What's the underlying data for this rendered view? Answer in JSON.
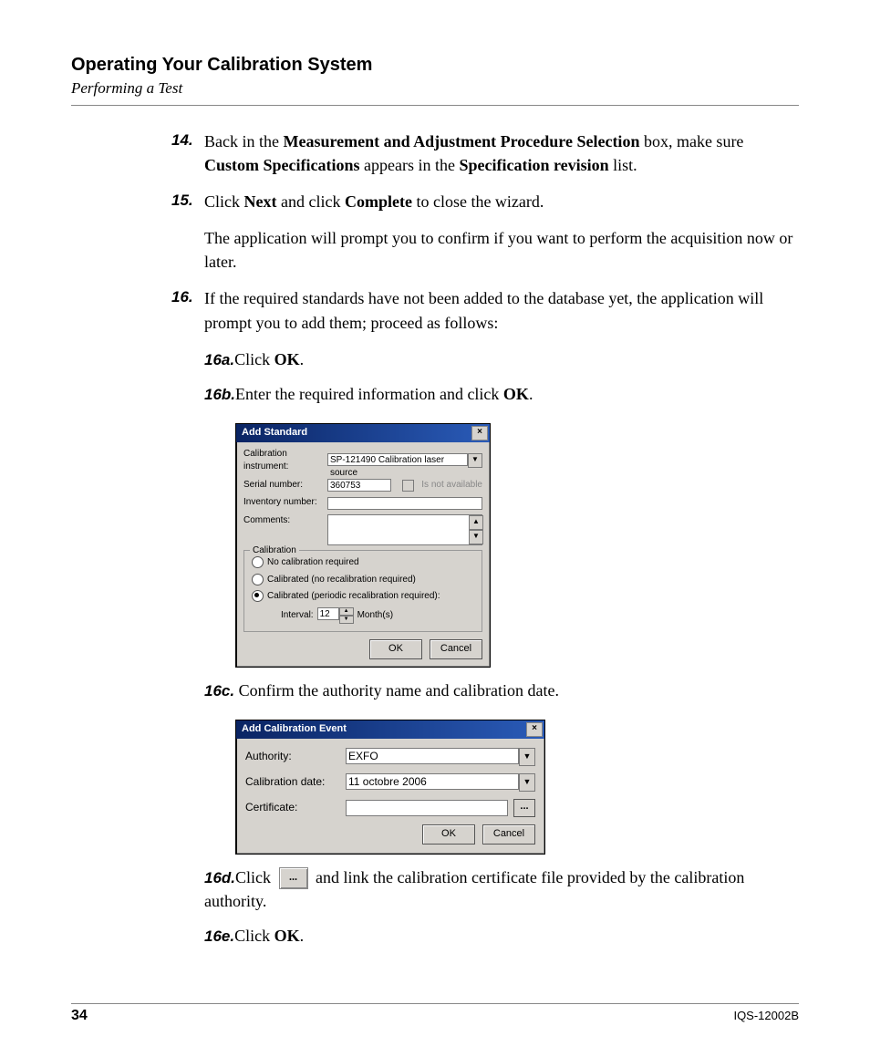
{
  "header": {
    "chapter_title": "Operating Your Calibration System",
    "section_title": "Performing a Test"
  },
  "steps": {
    "s14": {
      "num": "14.",
      "t1": "Back in the ",
      "b1": "Measurement and Adjustment Procedure Selection",
      "t2": " box, make sure ",
      "b2": "Custom Specifications",
      "t3": " appears in the ",
      "b3": "Specification revision",
      "t4": " list."
    },
    "s15": {
      "num": "15.",
      "t1": "Click ",
      "b1": "Next",
      "t2": " and click ",
      "b2": "Complete",
      "t3": " to close the wizard.",
      "p2": "The application will prompt you to confirm if you want to perform the acquisition now or later."
    },
    "s16": {
      "num": "16.",
      "text": "If the required standards have not been added to the database yet, the application will prompt you to add them; proceed as follows:",
      "a": {
        "num": "16a.",
        "t1": "Click ",
        "b1": "OK",
        "t2": "."
      },
      "b": {
        "num": "16b.",
        "t1": "Enter the required information and click ",
        "b1": "OK",
        "t2": "."
      },
      "c": {
        "num": "16c.",
        "text": " Confirm the authority name and calibration date."
      },
      "d": {
        "num": "16d.",
        "t1": "Click ",
        "t2": " and link the calibration certificate file provided by the calibration authority."
      },
      "e": {
        "num": "16e.",
        "t1": "Click ",
        "b1": "OK",
        "t2": "."
      }
    }
  },
  "dialog1": {
    "title": "Add Standard",
    "close": "×",
    "lbl_calibinstr": "Calibration instrument:",
    "val_calibinstr": "SP-121490 Calibration laser source",
    "lbl_serial": "Serial number:",
    "val_serial": "360753",
    "chk_label": "Is not available",
    "lbl_inv": "Inventory number:",
    "lbl_comments": "Comments:",
    "group_legend": "Calibration",
    "opt1": "No calibration required",
    "opt2": "Calibrated (no recalibration required)",
    "opt3": "Calibrated (periodic recalibration required):",
    "interval_lbl": "Interval:",
    "interval_val": "12",
    "interval_unit": "Month(s)",
    "ok": "OK",
    "cancel": "Cancel"
  },
  "dialog2": {
    "title": "Add Calibration Event",
    "close": "×",
    "lbl_auth": "Authority:",
    "val_auth": "EXFO",
    "lbl_date": "Calibration date:",
    "val_date": "11  octobre  2006",
    "lbl_cert": "Certificate:",
    "ellipsis": "...",
    "ok": "OK",
    "cancel": "Cancel"
  },
  "inline_ellipsis": "...",
  "footer": {
    "page": "34",
    "docid": "IQS-12002B"
  }
}
